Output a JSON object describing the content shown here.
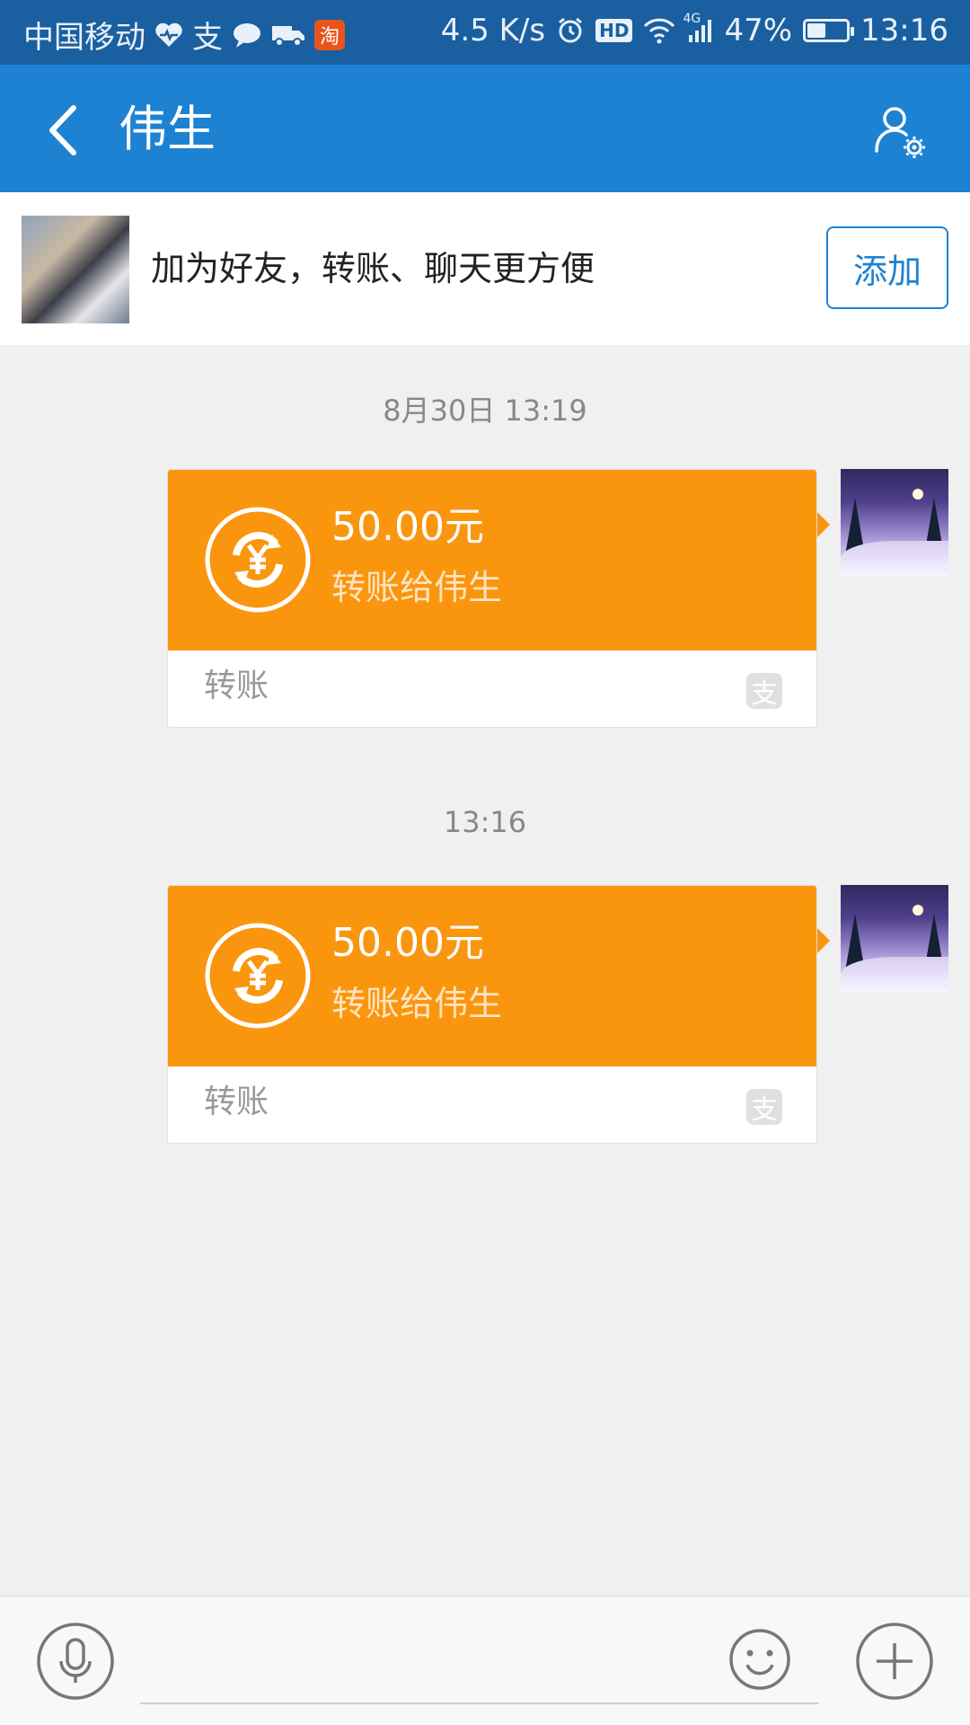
{
  "status_bar": {
    "carrier": "中国移动",
    "alipay_glyph": "支",
    "taobao_glyph": "淘",
    "net_speed": "4.5 K/s",
    "hd": "HD",
    "signal_type": "4G",
    "battery": "47%",
    "battery_level": 0.47,
    "time": "13:16"
  },
  "header": {
    "title": "伟生"
  },
  "banner": {
    "text": "加为好友，转账、聊天更方便",
    "add_label": "添加"
  },
  "messages": [
    {
      "timestamp": "8月30日 13:19",
      "amount": "50.00元",
      "description": "转账给伟生",
      "footer": "转账",
      "brand_glyph": "支"
    },
    {
      "timestamp": "13:16",
      "amount": "50.00元",
      "description": "转账给伟生",
      "footer": "转账",
      "brand_glyph": "支"
    }
  ],
  "colors": {
    "status_bar": "#1a5fa0",
    "app_bar": "#1e82d2",
    "transfer_card": "#fa960e",
    "chat_bg": "#f0f0f0"
  },
  "icons": [
    "back-arrow-icon",
    "user-settings-icon",
    "transfer-yuan-icon",
    "alipay-icon",
    "microphone-icon",
    "emoji-icon",
    "plus-icon"
  ]
}
